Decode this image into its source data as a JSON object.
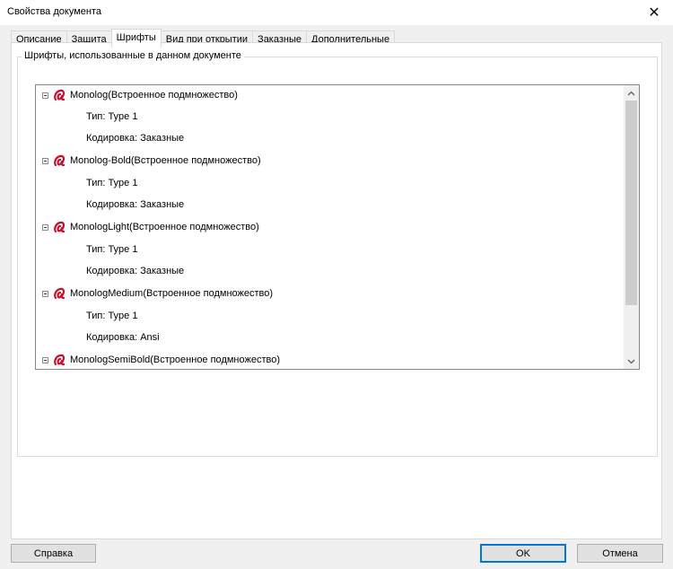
{
  "window": {
    "title": "Свойства документа",
    "close_glyph": "✕"
  },
  "tabs": [
    {
      "label": "Описание",
      "active": false
    },
    {
      "label": "Защита",
      "active": false
    },
    {
      "label": "Шрифты",
      "active": true
    },
    {
      "label": "Вид при открытии",
      "active": false
    },
    {
      "label": "Заказные",
      "active": false
    },
    {
      "label": "Дополнительные",
      "active": false
    }
  ],
  "fonts_group": {
    "legend": "Шрифты, использованные в данном документе",
    "fonts": [
      {
        "name": "Monolog(Встроенное подмножество)",
        "type": "Тип: Type 1",
        "encoding": "Кодировка: Заказные"
      },
      {
        "name": "Monolog-Bold(Встроенное подмножество)",
        "type": "Тип: Type 1",
        "encoding": "Кодировка: Заказные"
      },
      {
        "name": "MonologLight(Встроенное подмножество)",
        "type": "Тип: Type 1",
        "encoding": "Кодировка: Заказные"
      },
      {
        "name": "MonologMedium(Встроенное подмножество)",
        "type": "Тип: Type 1",
        "encoding": "Кодировка: Ansi"
      },
      {
        "name": "MonologSemiBold(Встроенное подмножество)"
      }
    ],
    "icon": "font-type1-icon",
    "icon_color": "#c8102e"
  },
  "buttons": {
    "help": "Справка",
    "ok": "OK",
    "cancel": "Отмена"
  },
  "colors": {
    "accent": "#0078d7"
  }
}
